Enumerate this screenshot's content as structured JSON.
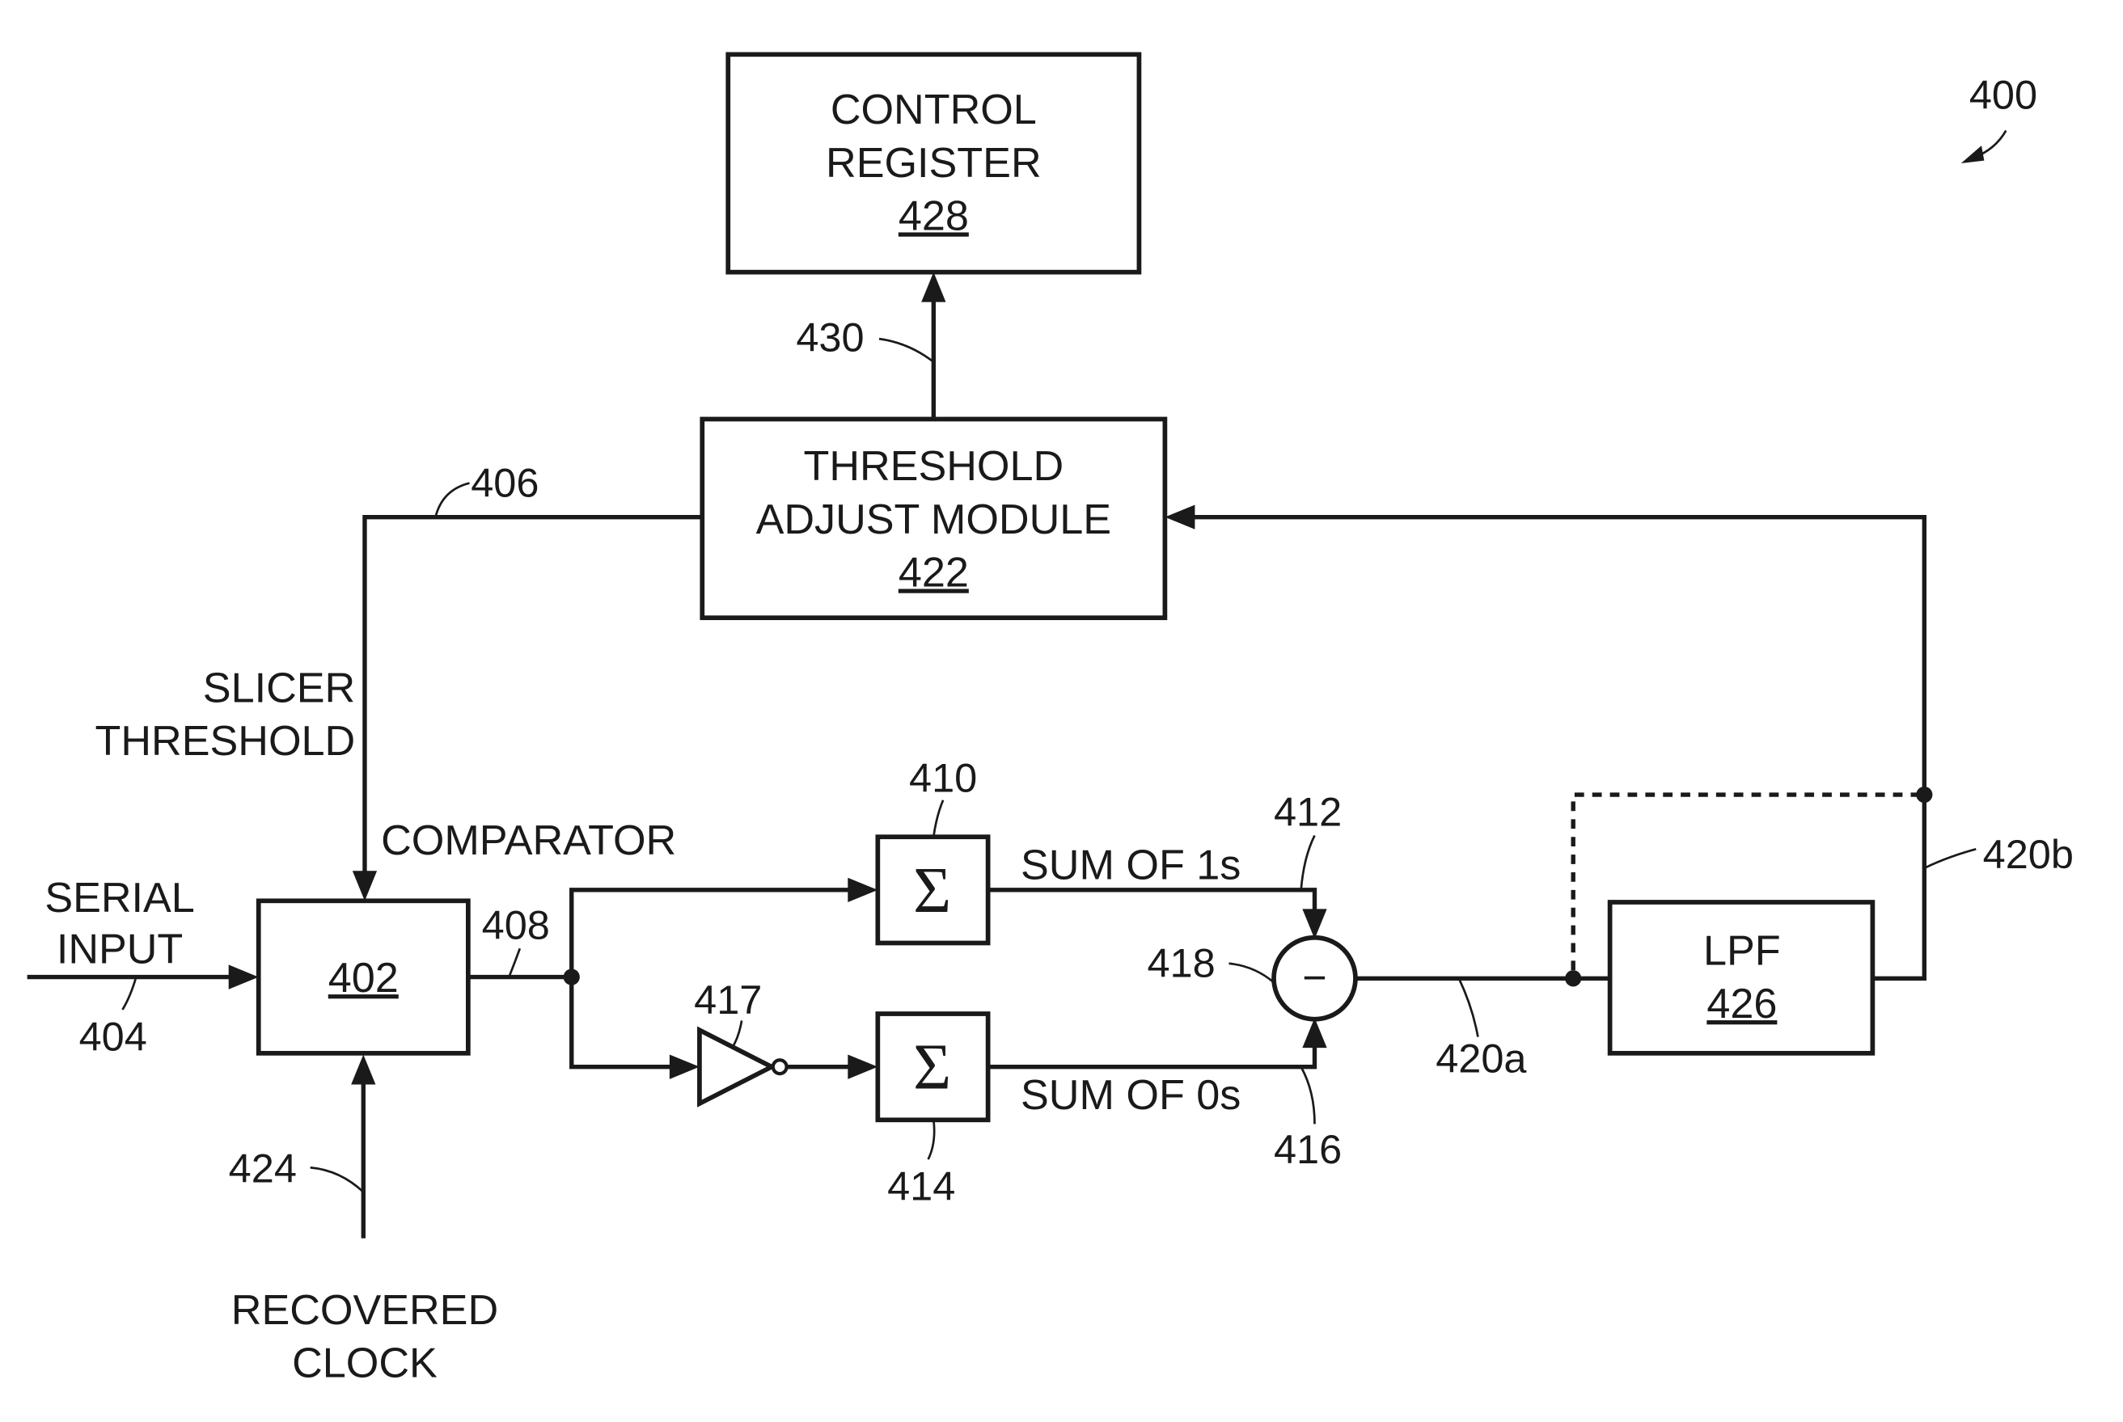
{
  "figure": {
    "number": "400",
    "blocks": {
      "control_register": {
        "line1": "CONTROL",
        "line2": "REGISTER",
        "ref": "428"
      },
      "threshold_adjust": {
        "line1": "THRESHOLD",
        "line2": "ADJUST MODULE",
        "ref": "422"
      },
      "comparator": {
        "ref": "402",
        "label": "COMPARATOR"
      },
      "sum_ones": {
        "symbol": "Σ",
        "ref": "410"
      },
      "sum_zeros": {
        "symbol": "Σ",
        "ref": "414"
      },
      "inverter": {
        "ref": "417"
      },
      "subtractor": {
        "symbol": "−",
        "ref": "418"
      },
      "lpf": {
        "line1": "LPF",
        "ref": "426"
      }
    },
    "signals": {
      "serial_input": {
        "line1": "SERIAL",
        "line2": "INPUT",
        "ref": "404"
      },
      "slicer_threshold": {
        "line1": "SLICER",
        "line2": "THRESHOLD",
        "ref": "406"
      },
      "comparator_out": {
        "ref": "408"
      },
      "sum_of_ones": {
        "label": "SUM OF 1s",
        "ref": "412"
      },
      "sum_of_zeros": {
        "label": "SUM OF 0s",
        "ref": "416"
      },
      "diff_out": {
        "ref": "420a"
      },
      "filtered_out": {
        "ref": "420b"
      },
      "recovered_clock": {
        "line1": "RECOVERED",
        "line2": "CLOCK",
        "ref": "424"
      },
      "register_write": {
        "ref": "430"
      }
    }
  }
}
